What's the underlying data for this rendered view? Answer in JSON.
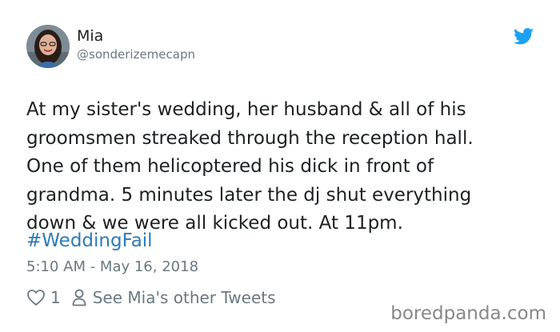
{
  "author": {
    "display_name": "Mia",
    "handle": "@sonderizemecapn"
  },
  "tweet": {
    "text": "At my sister's wedding, her husband & all of his\ngroomsmen streaked through the reception hall.\nOne of them helicoptered his dick in front of\ngrandma. 5 minutes later the dj shut everything\ndown & we were all kicked out. At 11pm.",
    "hashtag": "#WeddingFail",
    "timestamp": "5:10 AM - May 16, 2018"
  },
  "actions": {
    "like_count": "1",
    "see_other_label": "See Mia's other Tweets"
  },
  "watermark": "boredpanda.com",
  "icons": {
    "brand": "twitter-bird-icon",
    "like": "heart-icon",
    "profile": "person-icon"
  },
  "colors": {
    "twitter_blue": "#1da1f2",
    "link_blue": "#2b7bb9",
    "muted_gray": "#697882",
    "text_dark": "#1c2022"
  }
}
